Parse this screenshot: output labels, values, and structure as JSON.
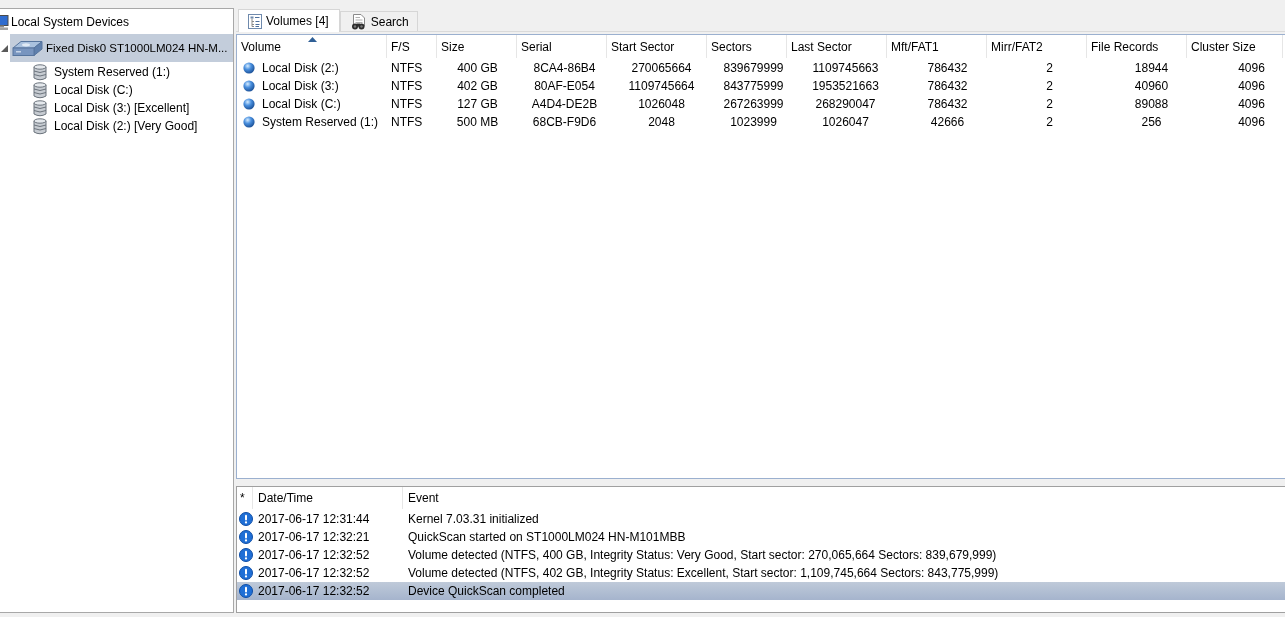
{
  "tree": {
    "items": [
      {
        "kind": "computer",
        "label": "Local System Devices",
        "selected": false,
        "children": [
          {
            "kind": "disk",
            "label": "Fixed Disk0 ST1000LM024 HN-M...",
            "selected": true,
            "expanded": true,
            "children": [
              {
                "kind": "volume",
                "label": "System Reserved (1:)",
                "selected": false
              },
              {
                "kind": "volume",
                "label": "Local Disk (C:)",
                "selected": false
              },
              {
                "kind": "volume",
                "label": "Local Disk (3:) [Excellent]",
                "selected": false
              },
              {
                "kind": "volume",
                "label": "Local Disk (2:) [Very Good]",
                "selected": false
              }
            ]
          }
        ]
      }
    ]
  },
  "tabs": [
    {
      "kind": "volumes",
      "label": "Volumes [4]",
      "selected": true
    },
    {
      "kind": "search",
      "label": "Search",
      "selected": false
    }
  ],
  "table": {
    "columns": [
      {
        "label": "Volume",
        "sorted": true
      },
      {
        "label": "F/S",
        "sorted": false
      },
      {
        "label": "Size",
        "sorted": false
      },
      {
        "label": "Serial",
        "sorted": false
      },
      {
        "label": "Start Sector",
        "sorted": false
      },
      {
        "label": "Sectors",
        "sorted": false
      },
      {
        "label": "Last Sector",
        "sorted": false
      },
      {
        "label": "Mft/FAT1",
        "sorted": false
      },
      {
        "label": "Mirr/FAT2",
        "sorted": false
      },
      {
        "label": "File Records",
        "sorted": false
      },
      {
        "label": "Cluster Size",
        "sorted": false
      }
    ],
    "rows": [
      {
        "selected": false,
        "cells": [
          "Local Disk (2:)",
          "NTFS",
          "400 GB",
          "8CA4-86B4",
          "270065664",
          "839679999",
          "1109745663",
          "786432",
          "2",
          "18944",
          "4096"
        ]
      },
      {
        "selected": false,
        "cells": [
          "Local Disk (3:)",
          "NTFS",
          "402 GB",
          "80AF-E054",
          "1109745664",
          "843775999",
          "1953521663",
          "786432",
          "2",
          "40960",
          "4096"
        ]
      },
      {
        "selected": false,
        "cells": [
          "Local Disk (C:)",
          "NTFS",
          "127 GB",
          "A4D4-DE2B",
          "1026048",
          "267263999",
          "268290047",
          "786432",
          "2",
          "89088",
          "4096"
        ]
      },
      {
        "selected": false,
        "cells": [
          "System Reserved (1:)",
          "NTFS",
          "500 MB",
          "68CB-F9D6",
          "2048",
          "1023999",
          "1026047",
          "42666",
          "2",
          "256",
          "4096"
        ]
      }
    ]
  },
  "log": {
    "columns": [
      "*",
      "Date/Time",
      "Event"
    ],
    "rows": [
      {
        "kind": "info",
        "time": "2017-06-17 12:31:44",
        "event": "Kernel 7.03.31 initialized",
        "selected": false
      },
      {
        "kind": "info",
        "time": "2017-06-17 12:32:21",
        "event": "QuickScan started on ST1000LM024 HN-M101MBB",
        "selected": false
      },
      {
        "kind": "info",
        "time": "2017-06-17 12:32:52",
        "event": "Volume detected (NTFS, 400 GB, Integrity Status: Very Good, Start sector: 270,065,664 Sectors: 839,679,999)",
        "selected": false
      },
      {
        "kind": "info",
        "time": "2017-06-17 12:32:52",
        "event": "Volume detected (NTFS, 402 GB, Integrity Status: Excellent, Start sector: 1,109,745,664 Sectors: 843,775,999)",
        "selected": false
      },
      {
        "kind": "info",
        "time": "2017-06-17 12:32:52",
        "event": "Device QuickScan completed",
        "selected": true
      }
    ]
  }
}
